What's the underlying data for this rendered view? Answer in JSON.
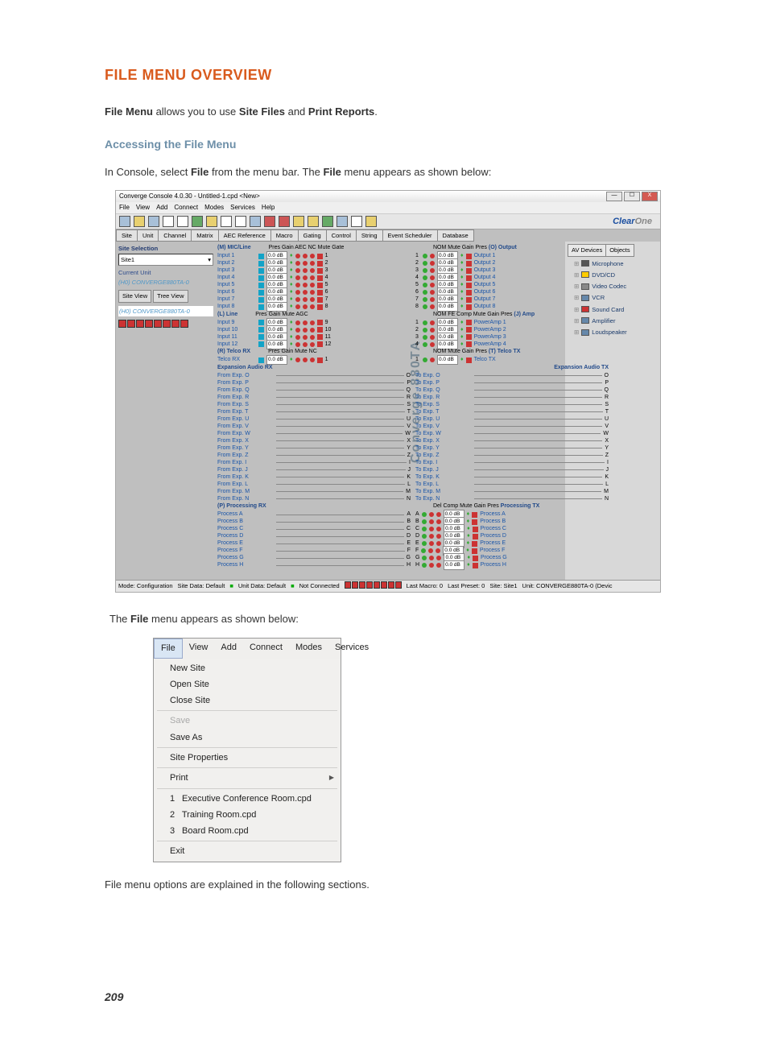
{
  "heading": "FILE MENU OVERVIEW",
  "intro": {
    "pre": "File Menu",
    "mid": " allows you to use ",
    "b2": "Site Files",
    "mid2": " and ",
    "b3": "Print Reports",
    "end": "."
  },
  "sub1": "Accessing the File Menu",
  "para1": {
    "a": "In Console, select ",
    "b": "File",
    "c": " from the menu bar. The ",
    "d": "File",
    "e": " menu appears as shown below:"
  },
  "para2": {
    "a": "The ",
    "b": "File",
    "c": " menu appears as shown below:"
  },
  "para3": "File menu options are explained in the following sections.",
  "page": "209",
  "shot1": {
    "title": "Converge Console 4.0.30 - Untitled-1.cpd <New>",
    "menus": [
      "File",
      "View",
      "Add",
      "Connect",
      "Modes",
      "Services",
      "Help"
    ],
    "brand": "Clear",
    "brand2": "One",
    "tabs": [
      "Site",
      "Unit",
      "Channel",
      "Matrix",
      "AEC Reference",
      "Macro",
      "Gating",
      "Control",
      "String",
      "Event Scheduler",
      "Database"
    ],
    "left": {
      "siteSel": "Site Selection",
      "site": "Site1",
      "curUnit": "Current Unit",
      "curUnitV": "(H0) CONVERGE880TA-0",
      "tabs": [
        "Site View",
        "Tree View"
      ],
      "tree": "(H0) CONVERGE880TA-0"
    },
    "right": {
      "tabs": [
        "AV Devices",
        "Objects"
      ],
      "items": [
        "Microphone",
        "DVD/CD",
        "Video Codec",
        "VCR",
        "Sound Card",
        "Amplifier",
        "Loudspeaker"
      ]
    },
    "cols": {
      "mic": {
        "t": "(M) MIC/Line",
        "hdr": "Pres     Gain     AEC  NC  Mute Gate",
        "n": 8,
        "pfx": "Input "
      },
      "out": {
        "t": "(O) Output",
        "hdr": "NOM         Mute       Gain    Pres",
        "n": 8,
        "pfx": "Output "
      },
      "line": {
        "t": "(L) Line",
        "hdr": "Pres     Gain         Mute  AGC",
        "n": 4,
        "pfx": "Input ",
        "start": 9
      },
      "amp": {
        "t": "(J) Amp",
        "hdr": "NOM FE Comp Mute   Gain   Pres",
        "n": 4,
        "pfx": "PowerAmp "
      },
      "trx": {
        "t": "(R) Telco RX",
        "hdr": "Pres     Gain       Mute  NC",
        "row": "Telco RX"
      },
      "ttx": {
        "t": "(T) Telco TX",
        "hdr": "NOM      Mute       Gain    Pres",
        "row": "Telco TX"
      },
      "erx": {
        "t": "Expansion Audio RX"
      },
      "etx": {
        "t": "Expansion Audio TX"
      },
      "prx": {
        "t": "(P) Processing RX"
      },
      "ptx": {
        "t": "Processing TX"
      },
      "exp": [
        "O",
        "P",
        "Q",
        "R",
        "S",
        "T",
        "U",
        "V",
        "W",
        "X",
        "Y",
        "Z",
        "I",
        "J",
        "K",
        "L",
        "M",
        "N"
      ],
      "proc": [
        "A",
        "B",
        "C",
        "D",
        "E",
        "F",
        "G",
        "H"
      ]
    },
    "stripe": "Converge 880TA",
    "status": {
      "mode": "Mode: Configuration",
      "sdata": "Site Data: Default",
      "udata": "Unit Data: Default",
      "conn": "Not Connected",
      "macro": "Last Macro: 0",
      "preset": "Last Preset: 0",
      "site": "Site: Site1",
      "unit": "Unit: CONVERGE880TA-0 (Devic"
    }
  },
  "shot2": {
    "menubar": [
      "File",
      "View",
      "Add",
      "Connect",
      "Modes",
      "Services"
    ],
    "items": [
      {
        "t": "New Site"
      },
      {
        "t": "Open Site"
      },
      {
        "t": "Close Site"
      },
      {
        "sep": true
      },
      {
        "t": "Save",
        "dis": true
      },
      {
        "t": "Save As"
      },
      {
        "sep": true
      },
      {
        "t": "Site Properties"
      },
      {
        "sep": true
      },
      {
        "t": "Print",
        "arrow": true
      },
      {
        "sep": true
      },
      {
        "t": "Executive Conference Room.cpd",
        "n": "1"
      },
      {
        "t": "Training Room.cpd",
        "n": "2"
      },
      {
        "t": "Board Room.cpd",
        "n": "3"
      },
      {
        "sep": true
      },
      {
        "t": "Exit"
      }
    ]
  }
}
